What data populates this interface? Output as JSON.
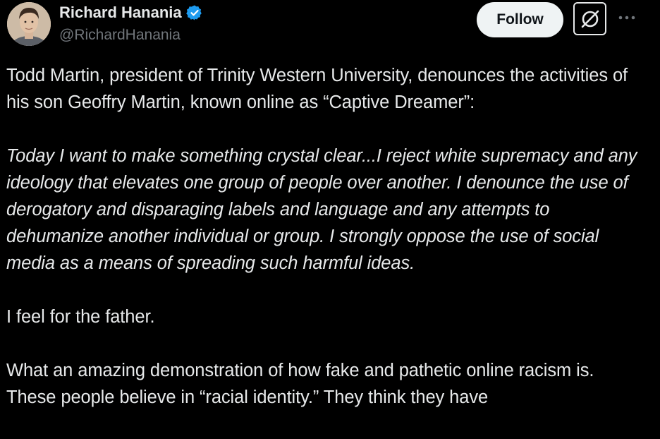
{
  "author": {
    "name": "Richard Hanania",
    "handle": "@RichardHanania",
    "verified": true,
    "verified_color": "#1d9bf0"
  },
  "actions": {
    "follow_label": "Follow",
    "grok_icon": "grok-icon",
    "more_icon": "more-horizontal-icon"
  },
  "tweet": {
    "paragraph_1": "Todd Martin, president of Trinity Western University, denounces the activities of his son Geoffry Martin, known online as “Captive Dreamer”:",
    "quote": "Today I want to make something crystal clear...I reject white supremacy and any ideology that elevates one group of people over another. I denounce the use of derogatory and disparaging labels and language and any attempts to dehumanize another individual or group. I strongly oppose the use of social media as a means of spreading such harmful ideas.",
    "paragraph_3": "I feel for the father.",
    "paragraph_4": "What an amazing demonstration of how fake and pathetic online racism is. These people believe in “racial identity.” They think they have"
  },
  "colors": {
    "background": "#000000",
    "text": "#e7e9ea",
    "secondary_text": "#71767b",
    "follow_bg": "#eff3f4",
    "follow_text": "#0f1419"
  }
}
